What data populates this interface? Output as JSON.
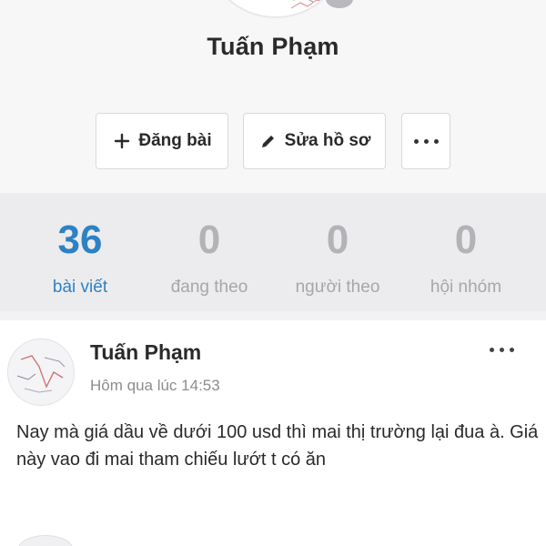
{
  "profile": {
    "name": "Tuấn Phạm"
  },
  "actions": {
    "post_label": "Đăng bài",
    "edit_label": "Sửa hồ sơ"
  },
  "stats": [
    {
      "value": "36",
      "label": "bài viết",
      "active": true
    },
    {
      "value": "0",
      "label": "đang theo",
      "active": false
    },
    {
      "value": "0",
      "label": "người theo",
      "active": false
    },
    {
      "value": "0",
      "label": "hội nhóm",
      "active": false
    }
  ],
  "post": {
    "author": "Tuấn Phạm",
    "time": "Hôm qua lúc 14:53",
    "text": "Nay mà giá dầu về dưới 100 usd thì mai thị trường lại đua à.  Giá này vao đi mai tham chiếu lướt t có ăn"
  },
  "colors": {
    "accent": "#2d82c4",
    "muted": "#b3b3b7"
  }
}
